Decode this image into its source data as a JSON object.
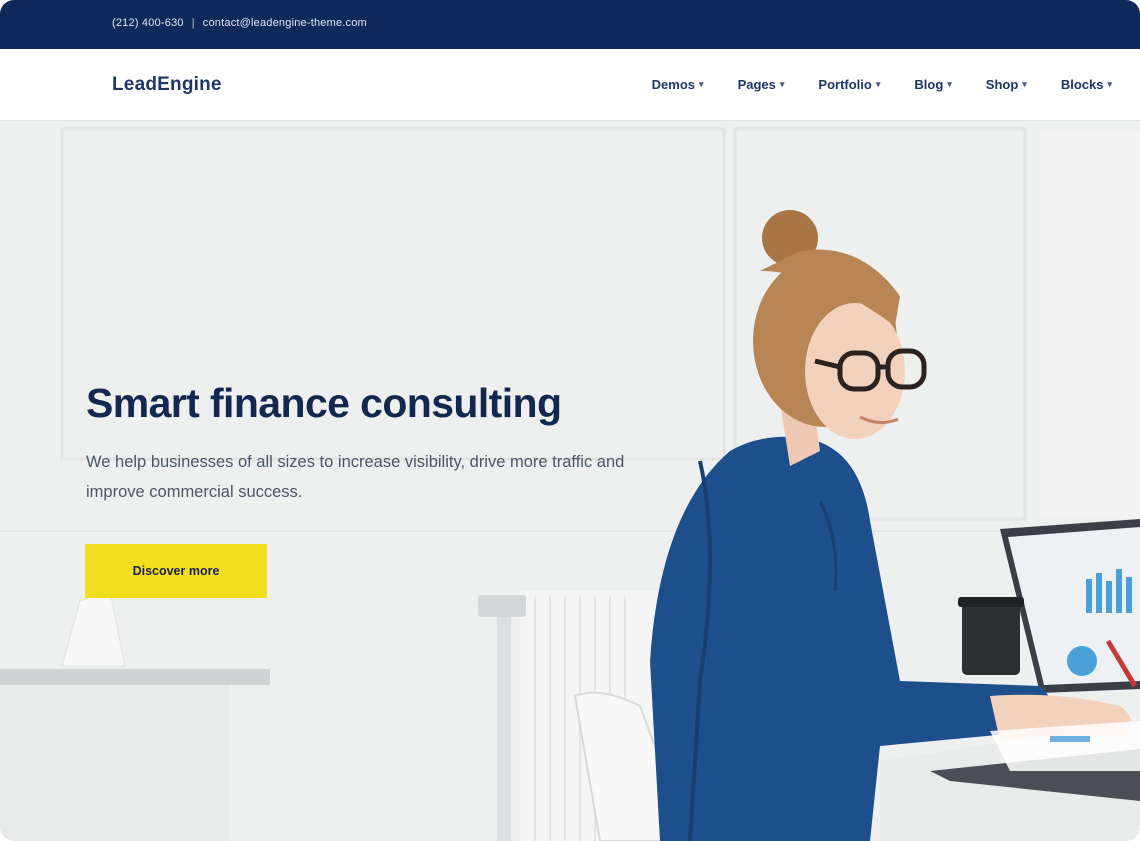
{
  "topbar": {
    "phone": "(212) 400-630",
    "separator": "|",
    "email": "contact@leadengine-theme.com"
  },
  "navbar": {
    "logo": "LeadEngine",
    "items": [
      {
        "label": "Demos",
        "icon": "chevron-down-icon"
      },
      {
        "label": "Pages",
        "icon": "chevron-down-icon"
      },
      {
        "label": "Portfolio",
        "icon": "chevron-down-icon"
      },
      {
        "label": "Blog",
        "icon": "chevron-down-icon"
      },
      {
        "label": "Shop",
        "icon": "chevron-down-icon"
      },
      {
        "label": "Blocks",
        "icon": "chevron-down-icon"
      }
    ]
  },
  "hero": {
    "title": "Smart finance consulting",
    "subtitle": "We help businesses of all sizes to increase visibility, drive more traffic and improve commercial success.",
    "cta_label": "Discover more"
  },
  "colors": {
    "topbar_bg": "#0e2a5a",
    "brand_navy": "#1f3767",
    "cta_yellow": "#f3dd1f",
    "jacket_blue": "#1d4f8c"
  }
}
